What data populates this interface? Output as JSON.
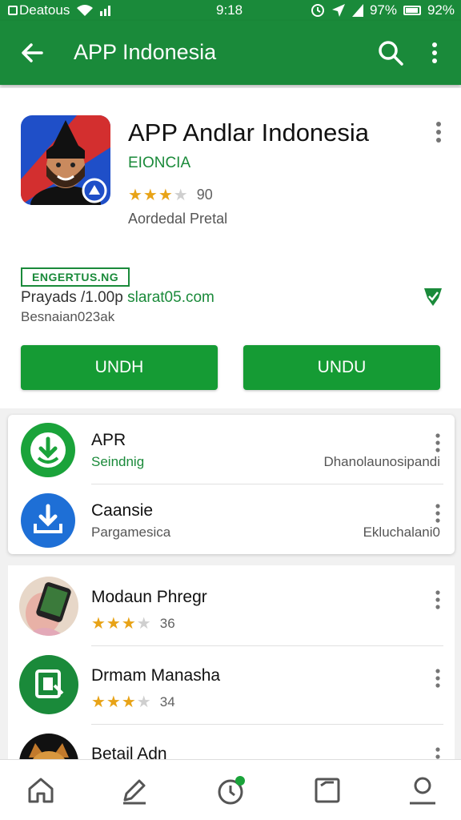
{
  "status_bar": {
    "carrier": "Deatous",
    "time": "9:18",
    "battery_pct_a": "97%",
    "battery_pct_b": "92%"
  },
  "app_bar": {
    "title": "APP Indonesia",
    "back_icon": "arrow-back-icon",
    "search_icon": "search-icon",
    "menu_icon": "more-vert-icon"
  },
  "app_detail": {
    "name": "APP Andlar Indonesia",
    "developer": "EIONCIA",
    "rating_value": 3.5,
    "rating_count": "90",
    "content_rating": "Aordedal Pretal",
    "badge": "ENGERTUS.NG",
    "info_prefix": "Prayads /1.00p ",
    "info_link": "slarat05.com",
    "info_line2": "Besnaian023ak",
    "button_left": "UNDH",
    "button_right": "UNDU"
  },
  "downloads": [
    {
      "title": "APR",
      "subtitle": "Seindnig",
      "right_text": "Dhanolaunosipandi",
      "icon": "download-shield-icon"
    },
    {
      "title": "Caansie",
      "subtitle": "Pargamesica",
      "right_text": "Ekluchalani0",
      "icon": "download-tray-icon"
    }
  ],
  "similar_apps": [
    {
      "name": "Modaun Phregr",
      "rating_value": 3.5,
      "rating_count": "36"
    },
    {
      "name": "Drmam Manasha",
      "rating_value": 3.5,
      "rating_count": "34"
    },
    {
      "name": "Betail Adn"
    }
  ],
  "bottom_nav": [
    "home-icon",
    "edit-icon",
    "clock-icon",
    "library-icon",
    "account-icon"
  ],
  "colors": {
    "primary": "#1a8a3a",
    "button": "#159b34",
    "star": "#e8a317"
  }
}
